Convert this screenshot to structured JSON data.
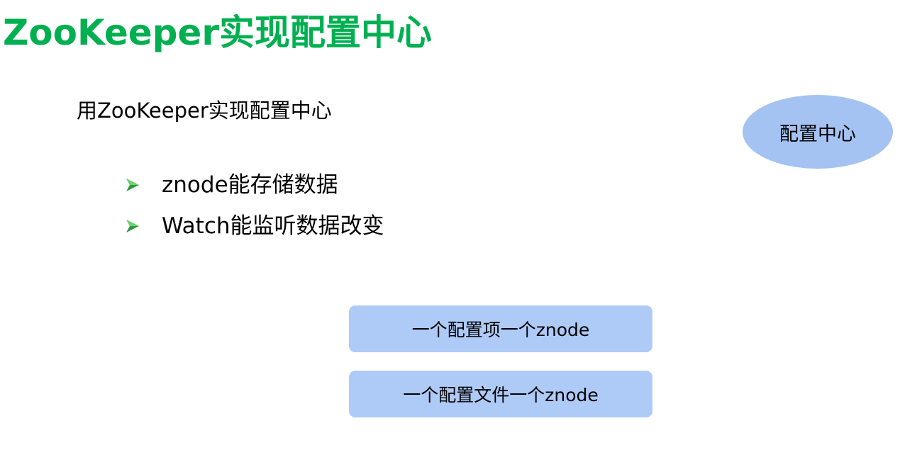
{
  "slide": {
    "title": "ZooKeeper实现配置中心",
    "subtitle": "用ZooKeeper实现配置中心",
    "bullets": [
      {
        "text": "znode能存储数据"
      },
      {
        "text": "Watch能监听数据改变"
      }
    ],
    "bullet_icon": "green-arrowhead-icon",
    "ellipse_label": "配置中心",
    "boxes": [
      {
        "label": "一个配置项一个znode"
      },
      {
        "label": "一个配置文件一个znode"
      }
    ],
    "colors": {
      "title": "#00b050",
      "bullet_arrow": "#2e9a3c",
      "ellipse_fill": "#a4c3f2",
      "box_fill": "#aecaf7"
    }
  }
}
